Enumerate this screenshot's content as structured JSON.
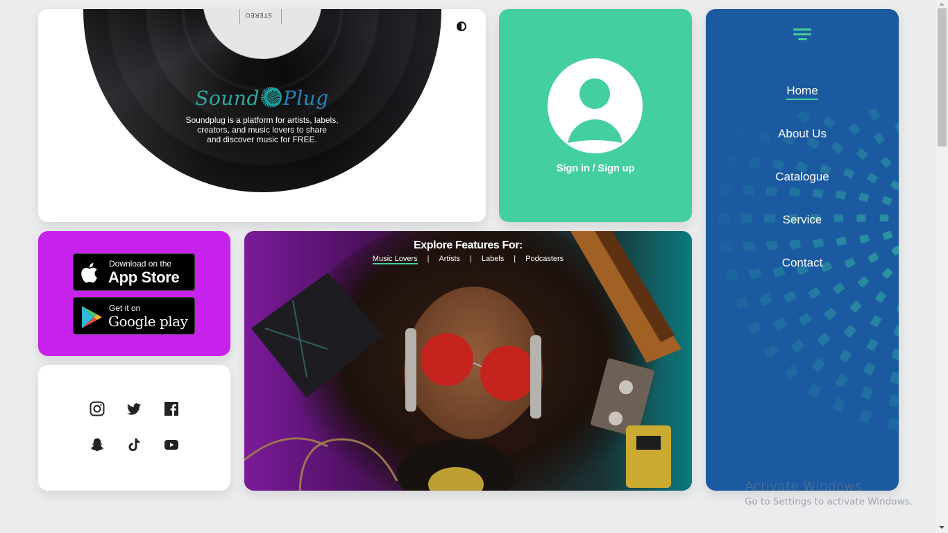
{
  "hero": {
    "label_text": "STEREO",
    "logo_left": "Sound",
    "logo_right": "Plug",
    "tagline_lines": [
      "Soundplug is a platform for artists, labels,",
      "creators, and music lovers to share",
      "and discover music for FREE."
    ],
    "theme_toggle_icon": "contrast-icon"
  },
  "signin": {
    "icon": "user-avatar-icon",
    "label": "Sign in / Sign up"
  },
  "nav": {
    "menu_icon": "hamburger-icon",
    "items": [
      {
        "label": "Home",
        "active": true
      },
      {
        "label": "About Us",
        "active": false
      },
      {
        "label": "Catalogue",
        "active": false
      },
      {
        "label": "Service",
        "active": false
      },
      {
        "label": "Contact",
        "active": false
      }
    ]
  },
  "stores": {
    "appstore": {
      "small": "Download on the",
      "big": "App Store",
      "icon": "apple-icon"
    },
    "playstore": {
      "small": "Get it on",
      "big": "Google play",
      "icon": "google-play-icon"
    }
  },
  "socials": [
    {
      "name": "instagram",
      "icon": "instagram-icon"
    },
    {
      "name": "twitter",
      "icon": "twitter-icon"
    },
    {
      "name": "facebook",
      "icon": "facebook-icon"
    },
    {
      "name": "snapchat",
      "icon": "snapchat-icon"
    },
    {
      "name": "tiktok",
      "icon": "tiktok-icon"
    },
    {
      "name": "youtube",
      "icon": "youtube-icon"
    }
  ],
  "explore": {
    "title": "Explore Features For:",
    "tabs": [
      {
        "label": "Music Lovers",
        "active": true
      },
      {
        "label": "Artists",
        "active": false
      },
      {
        "label": "Labels",
        "active": false
      },
      {
        "label": "Podcasters",
        "active": false
      }
    ],
    "separator": "|"
  },
  "watermark": {
    "line1": "Activate Windows",
    "line2": "Go to Settings to activate Windows."
  },
  "colors": {
    "background": "#ebecee",
    "accent_green": "#43cf9f",
    "nav_blue": "#1b5aa0",
    "store_purple": "#c722ec"
  }
}
